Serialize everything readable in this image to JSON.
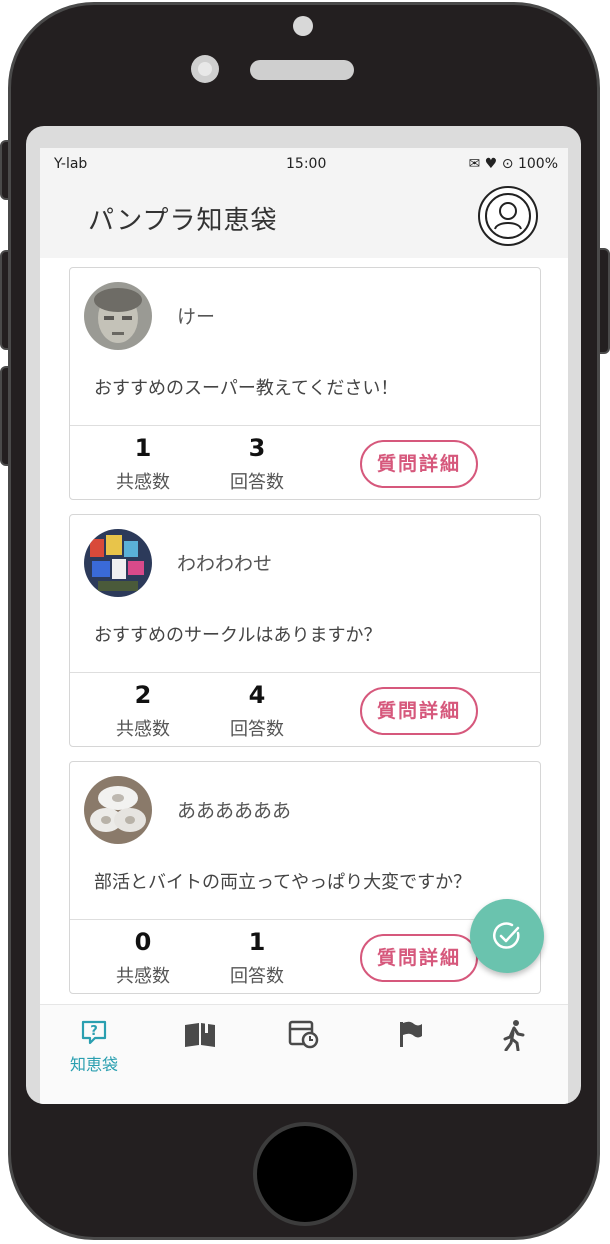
{
  "status_bar": {
    "carrier": "Y-lab",
    "time": "15:00",
    "icons": [
      "mail-icon",
      "heart-icon",
      "alarm-icon"
    ],
    "battery": "100%"
  },
  "app_bar": {
    "title": "パンプラ知恵袋"
  },
  "labels": {
    "likes": "共感数",
    "answers": "回答数",
    "detail_button": "質問詳細"
  },
  "questions": [
    {
      "user": "けー",
      "text": "おすすめのスーパー教えてください！",
      "likes": "1",
      "answers": "3"
    },
    {
      "user": "わわわわせ",
      "text": "おすすめのサークルはありますか？",
      "likes": "2",
      "answers": "4"
    },
    {
      "user": "ああああああ",
      "text": "部活とバイトの両立ってやっぱり大変ですか？",
      "likes": "0",
      "answers": "1"
    }
  ],
  "bottom_nav": {
    "active_label": "知恵袋",
    "items": [
      "question-icon",
      "book-icon",
      "calendar-clock-icon",
      "flag-icon",
      "walking-icon"
    ]
  },
  "colors": {
    "accent": "#d6587c",
    "nav_active": "#2a9fb0",
    "fab": "#6ac3ae"
  }
}
